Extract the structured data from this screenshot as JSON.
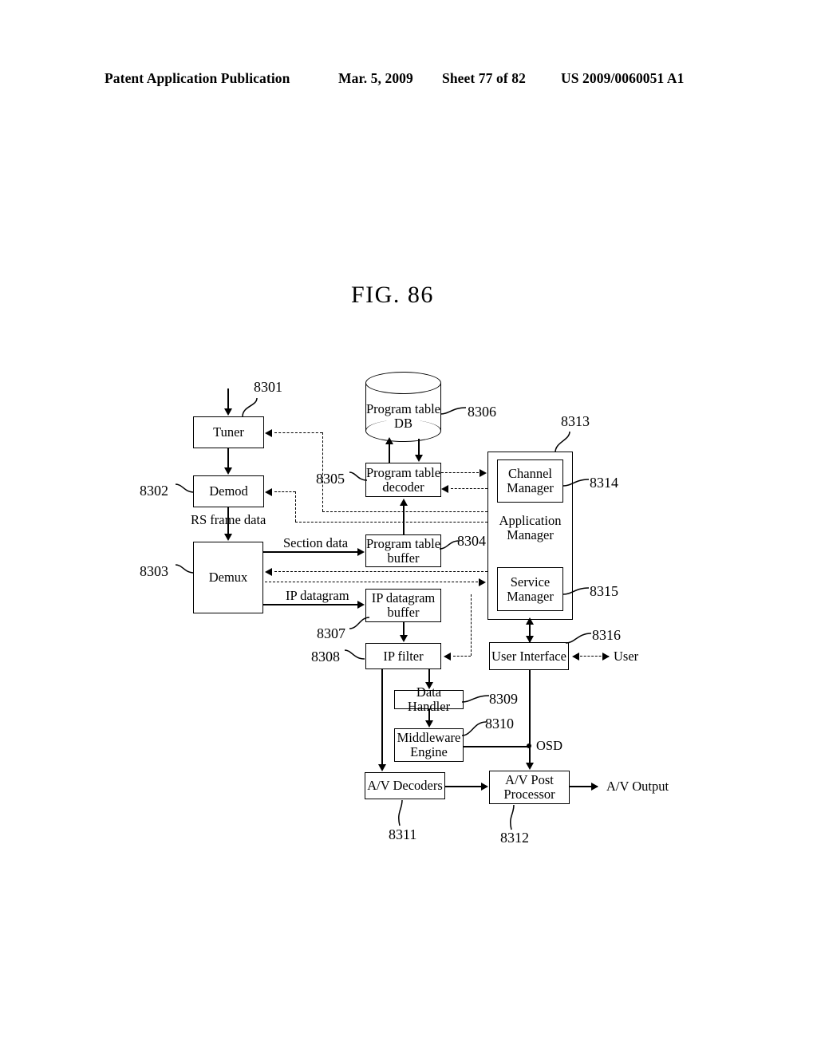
{
  "header": {
    "publication": "Patent Application Publication",
    "date": "Mar. 5, 2009",
    "sheet": "Sheet 77 of 82",
    "patent_number": "US 2009/0060051 A1"
  },
  "figure": {
    "title": "FIG. 86"
  },
  "blocks": {
    "tuner": "Tuner",
    "demod": "Demod",
    "demux": "Demux",
    "program_table_db": "Program table\nDB",
    "program_table_db_line1": "Program table",
    "program_table_db_line2": "DB",
    "program_table_decoder_line1": "Program table",
    "program_table_decoder_line2": "decoder",
    "program_table_buffer_line1": "Program table",
    "program_table_buffer_line2": "buffer",
    "ip_datagram_buffer_line1": "IP datagram",
    "ip_datagram_buffer_line2": "buffer",
    "ip_filter": "IP filter",
    "data_handler": "Data Handler",
    "middleware_engine_line1": "Middleware",
    "middleware_engine_line2": "Engine",
    "av_decoders": "A/V Decoders",
    "av_post_processor_line1": "A/V Post",
    "av_post_processor_line2": "Processor",
    "application_manager_line1": "Application",
    "application_manager_line2": "Manager",
    "channel_manager_line1": "Channel",
    "channel_manager_line2": "Manager",
    "service_manager_line1": "Service",
    "service_manager_line2": "Manager",
    "user_interface": "User Interface"
  },
  "flow_labels": {
    "rs_frame_data": "RS frame data",
    "section_data": "Section data",
    "ip_datagram": "IP datagram",
    "osd": "OSD",
    "user": "User",
    "av_output": "A/V Output"
  },
  "reference_numerals": {
    "tuner": "8301",
    "demod": "8302",
    "demux": "8303",
    "program_table_buffer": "8304",
    "program_table_decoder": "8305",
    "program_table_db": "8306",
    "ip_datagram_buffer": "8307",
    "ip_filter": "8308",
    "data_handler": "8309",
    "middleware_engine": "8310",
    "av_decoders": "8311",
    "av_post_processor": "8312",
    "application_manager": "8313",
    "channel_manager": "8314",
    "service_manager": "8315",
    "user_interface": "8316"
  }
}
